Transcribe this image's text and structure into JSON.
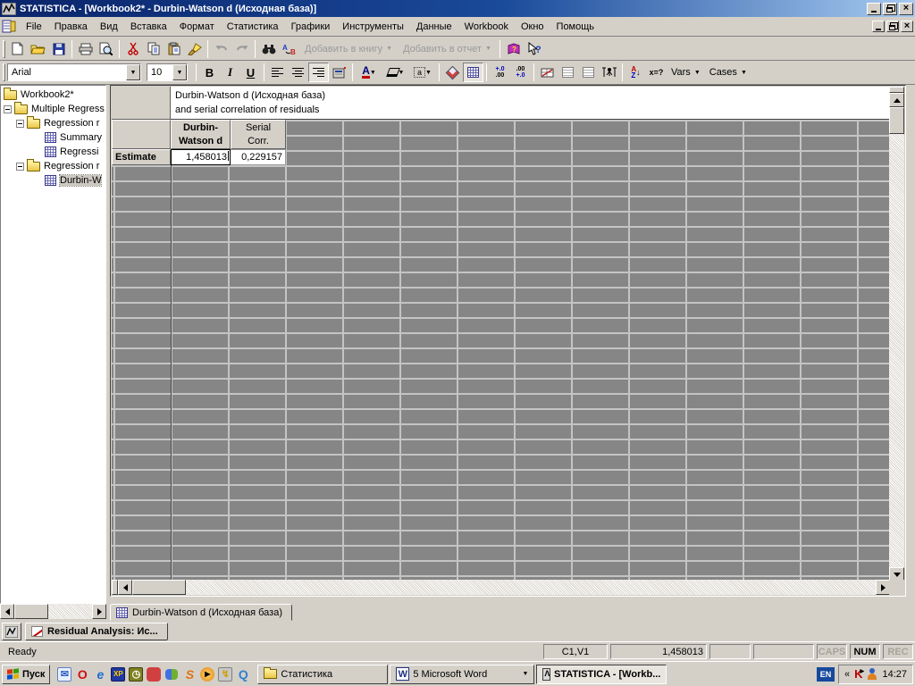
{
  "window": {
    "title": "STATISTICA - [Workbook2* - Durbin-Watson d (Исходная база)]",
    "app_icon": "statistica-logo"
  },
  "menu": {
    "items": [
      "File",
      "Правка",
      "Вид",
      "Вставка",
      "Формат",
      "Статистика",
      "Графики",
      "Инструменты",
      "Данные",
      "Workbook",
      "Окно",
      "Помощь"
    ]
  },
  "toolbar_standard": {
    "icons": [
      "new-document",
      "open-folder",
      "save-floppy",
      "print",
      "print-preview",
      "cut-scissors",
      "copy",
      "paste",
      "format-brush",
      "undo",
      "redo",
      "find-binoculars",
      "replace-ab",
      "add-book-help",
      "help-pointer"
    ],
    "add_to_book_label": "Добавить в книгу",
    "add_to_report_label": "Добавить в отчет"
  },
  "toolbar_format": {
    "font_name": "Arial",
    "font_size": "10",
    "bold_label": "B",
    "italic_label": "I",
    "underline_label": "U",
    "font_color_label": "A",
    "border_label": "a",
    "inc_decimal_label": "+.0 .00",
    "dec_decimal_label": ".00 +.0",
    "sort_label": "AZ",
    "xq_label": "x=?",
    "vars_label": "Vars",
    "cases_label": "Cases"
  },
  "tree": {
    "items": [
      {
        "label": "Workbook2*",
        "type": "folder"
      },
      {
        "label": "Multiple Regress",
        "type": "folder"
      },
      {
        "label": "Regression r",
        "type": "folder"
      },
      {
        "label": "Summary",
        "type": "sheet"
      },
      {
        "label": "Regressi",
        "type": "sheet"
      },
      {
        "label": "Regression r",
        "type": "folder"
      },
      {
        "label": "Durbin-W",
        "type": "sheet",
        "selected": true
      }
    ]
  },
  "spreadsheet": {
    "title_line1": "Durbin-Watson d (Исходная база)",
    "title_line2": "and serial correlation of residuals",
    "columns": [
      {
        "line1": "Durbin-",
        "line2": "Watson d"
      },
      {
        "line1": "Serial",
        "line2": "Corr."
      }
    ],
    "row_label": "Estimate",
    "values": [
      "1,458013",
      "0,229157"
    ]
  },
  "tabs": {
    "sheet_tab": "Durbin-Watson d (Исходная база)",
    "analysis_tab": "Residual Analysis: Ис..."
  },
  "statusbar": {
    "ready": "Ready",
    "cell_ref": "C1,V1",
    "cell_value": "1,458013",
    "caps": "CAPS",
    "num": "NUM",
    "rec": "REC"
  },
  "taskbar": {
    "start_label": "Пуск",
    "quicklaunch_icons": [
      "outlook-express",
      "opera",
      "internet-explorer",
      "floppy-xp",
      "scheduler",
      "mail",
      "msn-messenger",
      "statsoft",
      "media-player",
      "winamp",
      "quicktime"
    ],
    "tasks": [
      {
        "label": "Статистика",
        "icon": "folder"
      },
      {
        "label": "5 Microsoft Word",
        "icon": "word",
        "dropdown": true
      },
      {
        "label": "STATISTICA - [Workb...",
        "icon": "statistica",
        "active": true
      }
    ],
    "tray": {
      "lang": "EN",
      "chevron": "«",
      "time": "14:27"
    }
  },
  "colors": {
    "titlebar_start": "#0a246a",
    "titlebar_end": "#a6caf0",
    "chrome": "#d4d0c8",
    "grid_cell": "#868686",
    "grid_line": "#c4c4c4"
  }
}
